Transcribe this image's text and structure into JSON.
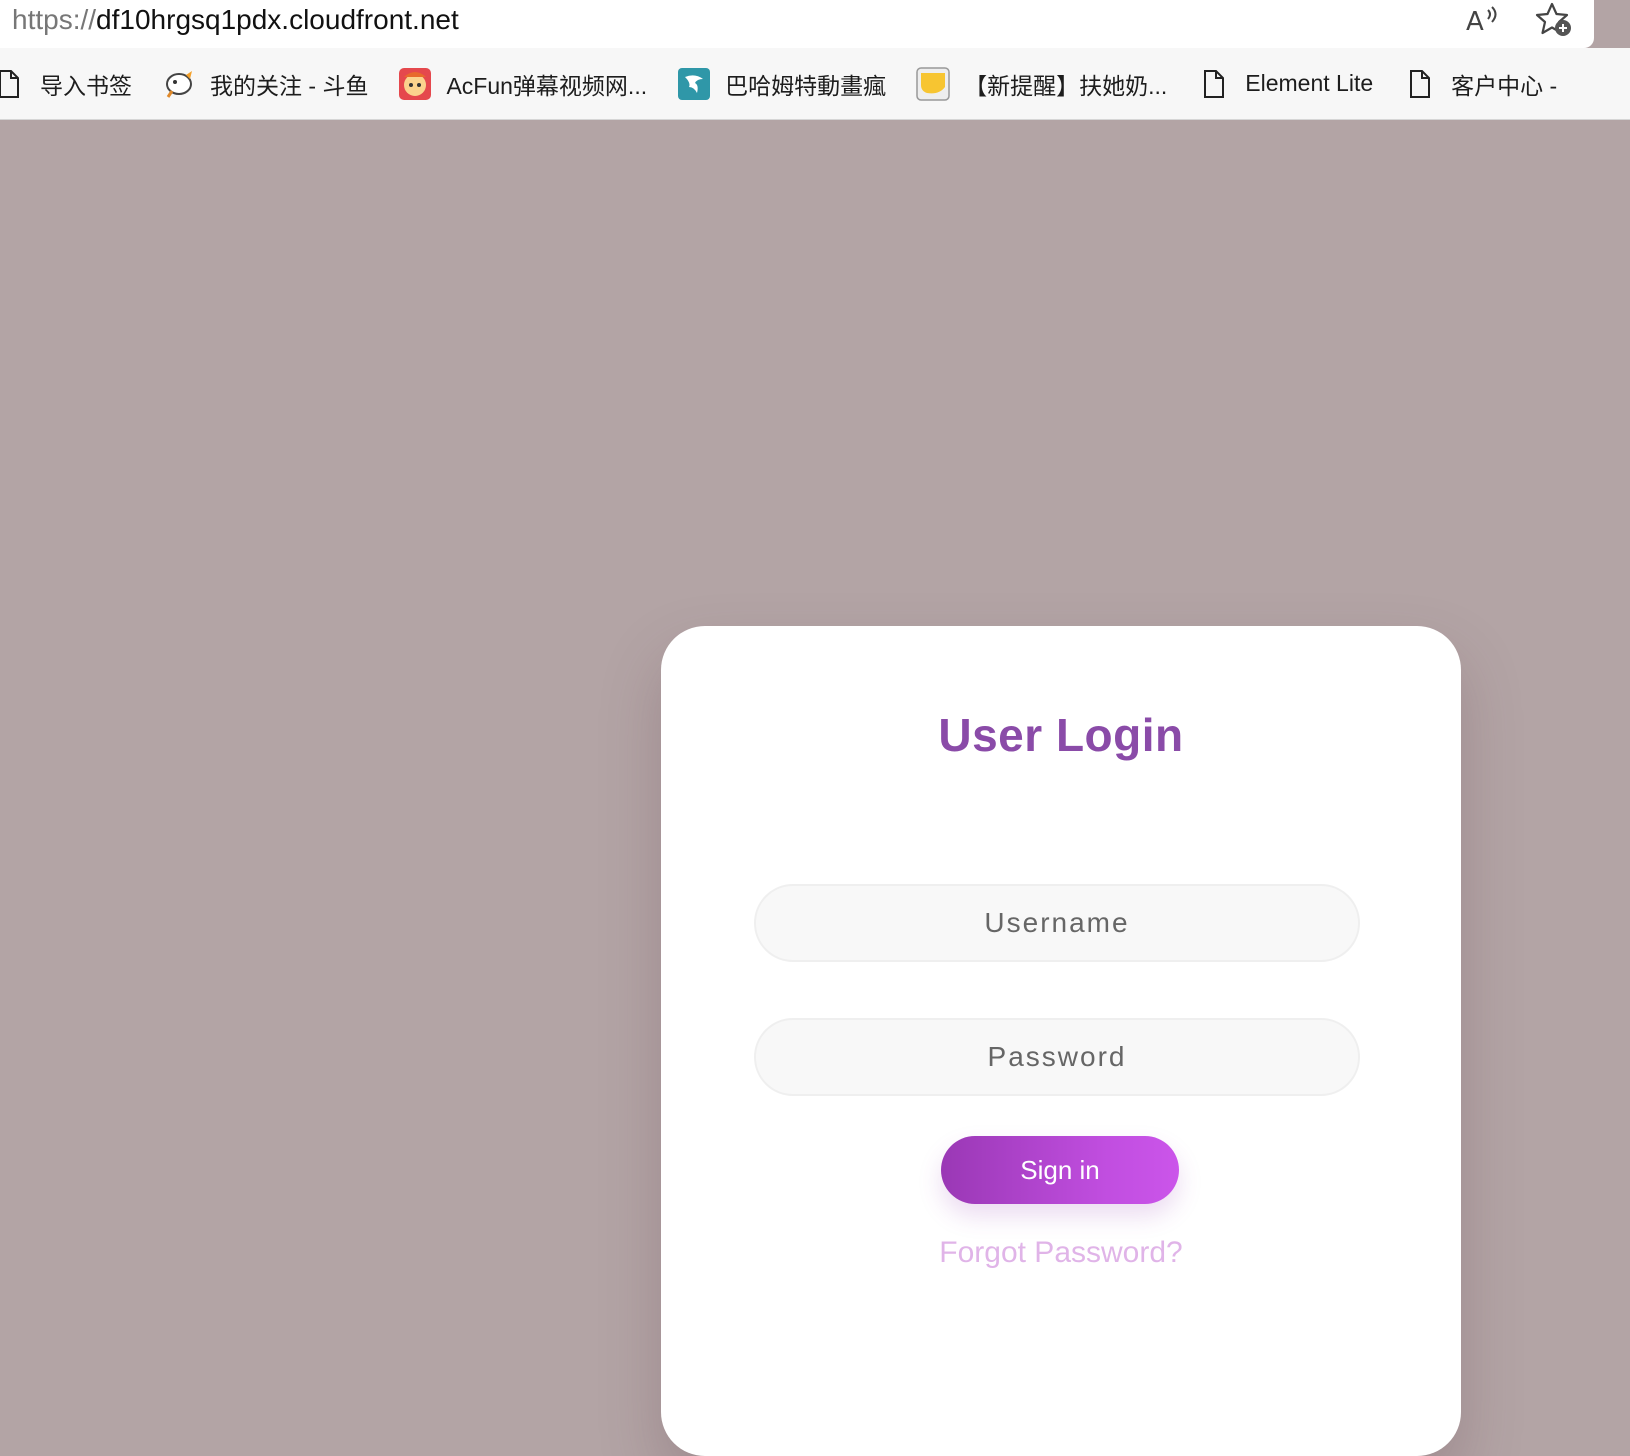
{
  "browser": {
    "url_scheme": "https://",
    "url_host": "df10hrgsq1pdx.cloudfront.net",
    "read_aloud_icon": "A",
    "icons": [
      "read-aloud-icon",
      "add-favorite-icon"
    ]
  },
  "bookmarks": [
    {
      "label": "导入书签",
      "icon": "document-icon"
    },
    {
      "label": "我的关注 - 斗鱼",
      "icon": "douyu-fish-icon"
    },
    {
      "label": "AcFun弹幕视频网...",
      "icon": "acfun-icon"
    },
    {
      "label": "巴哈姆特動畫瘋",
      "icon": "bahamut-icon"
    },
    {
      "label": "【新提醒】扶她奶...",
      "icon": "forum-icon"
    },
    {
      "label": "Element Lite",
      "icon": "document-icon"
    },
    {
      "label": "客户中心 - ",
      "icon": "document-icon"
    }
  ],
  "login": {
    "title": "User Login",
    "username_placeholder": "Username",
    "password_placeholder": "Password",
    "signin_label": "Sign in",
    "forgot_label": "Forgot Password?"
  },
  "colors": {
    "page_background": "#b3a4a5",
    "title": "#8a4ba8",
    "button_start": "#9a38b5",
    "button_end": "#cb55ea",
    "forgot_link": "#e0b4e8"
  }
}
